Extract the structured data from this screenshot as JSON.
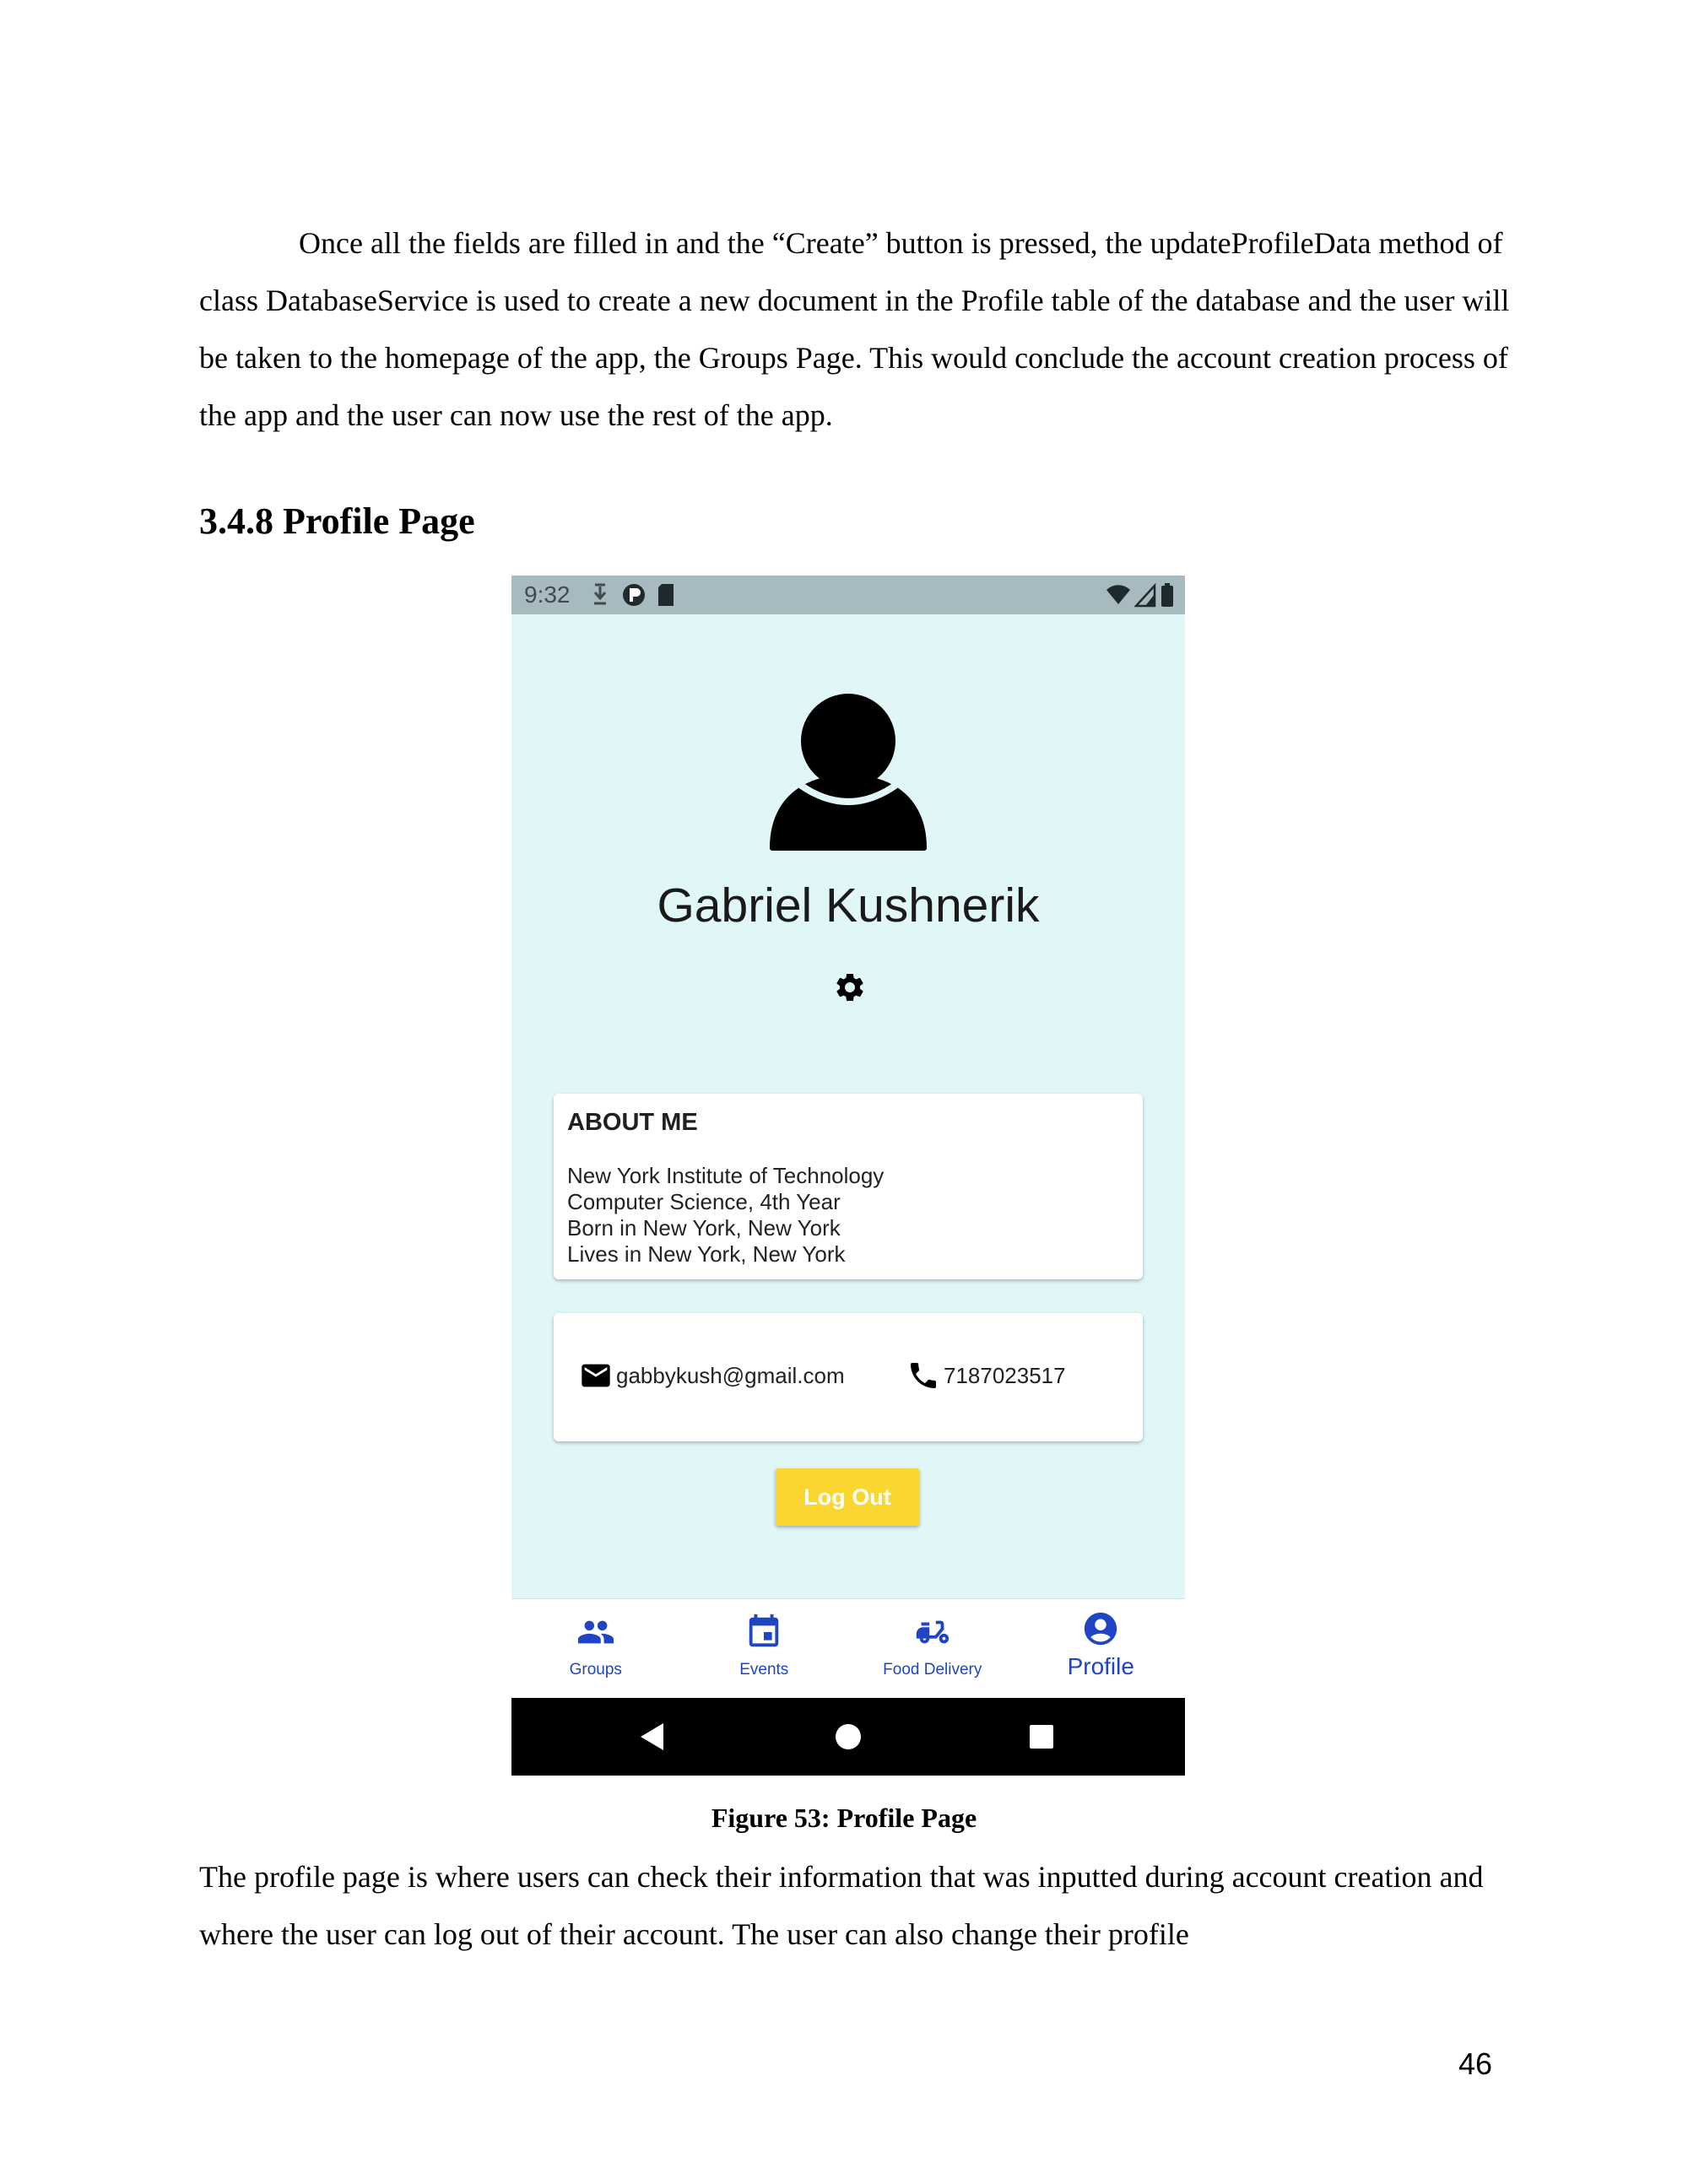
{
  "document": {
    "intro_paragraph": "Once all the fields are filled in and the “Create” button is pressed, the updateProfileData method of class DatabaseService is used to create a new document in the Profile table of the database and the user will be taken to the homepage of the app, the Groups Page. This would conclude the account creation process of the app and the user can now use the rest of the app.",
    "section_heading": "3.4.8 Profile Page",
    "figure_caption": "Figure 53: Profile Page",
    "closing_paragraph": "The profile page is where users can check their information that was inputted during account creation and where the user can log out of their account. The user can also change their profile",
    "page_number": "46"
  },
  "phone": {
    "status_bar": {
      "time": "9:32",
      "left_icons": [
        "download-icon",
        "app-notification-icon",
        "sd-card-icon"
      ],
      "right_icons": [
        "wifi-icon",
        "cell-signal-icon",
        "battery-icon"
      ]
    },
    "profile": {
      "name": "Gabriel Kushnerik",
      "avatar_icon": "person-icon",
      "settings_icon": "gear-icon"
    },
    "about": {
      "title": "ABOUT ME",
      "lines": [
        "New York Institute of Technology",
        "Computer Science, 4th Year",
        "Born in New York, New York",
        "Lives in New York, New York"
      ]
    },
    "contact": {
      "email": "gabbykush@gmail.com",
      "phone": "7187023517"
    },
    "logout_label": "Log Out",
    "bottom_nav": [
      {
        "label": "Groups",
        "icon": "group-icon",
        "active": false
      },
      {
        "label": "Events",
        "icon": "calendar-icon",
        "active": false
      },
      {
        "label": "Food Delivery",
        "icon": "delivery-scooter-icon",
        "active": false
      },
      {
        "label": "Profile",
        "icon": "account-circle-icon",
        "active": true
      }
    ],
    "colors": {
      "status_bar": "#a7babf",
      "background": "#e0f6f7",
      "accent_blue": "#1f44c4",
      "logout_button": "#fbd631"
    }
  }
}
